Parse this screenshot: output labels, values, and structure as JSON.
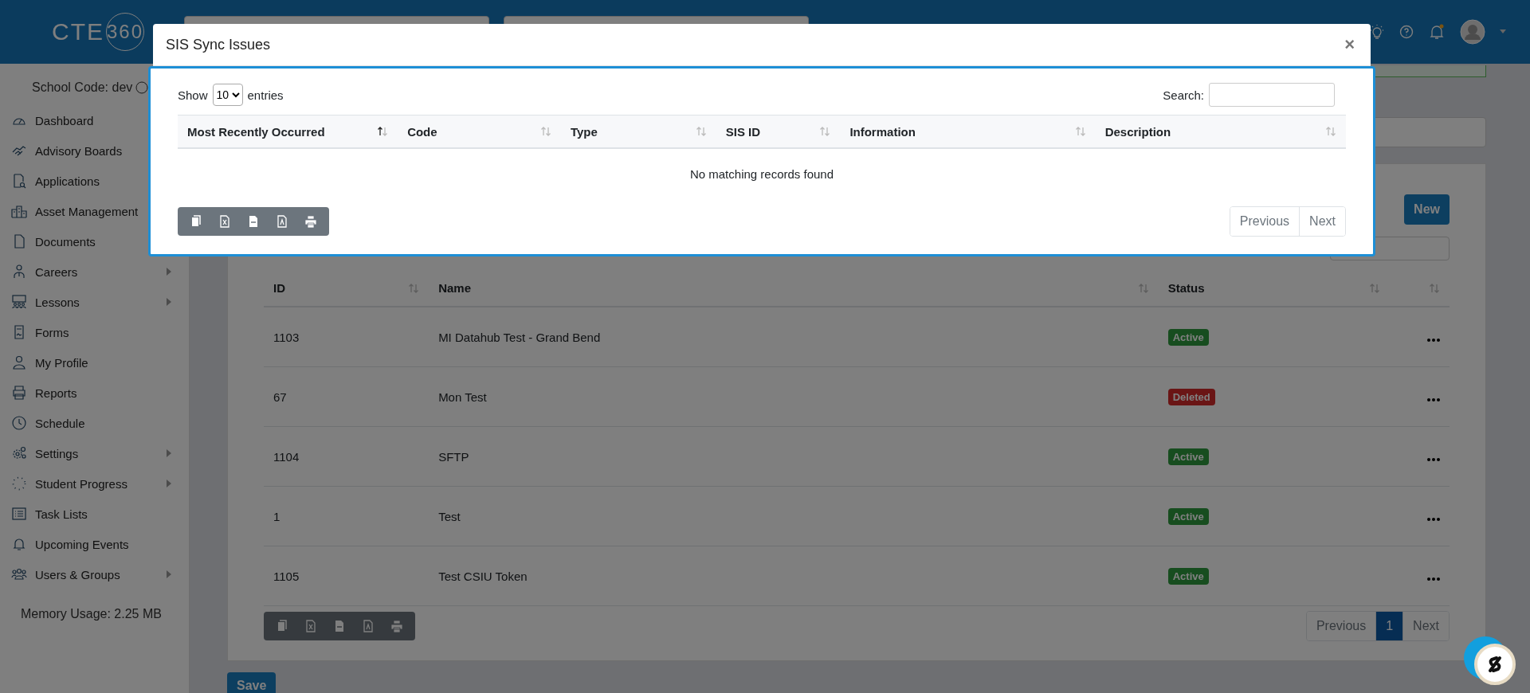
{
  "header": {
    "logo": {
      "text": "CTE",
      "badge": "360"
    }
  },
  "sidebar": {
    "school_code": "School Code: dev",
    "items": [
      {
        "label": "Dashboard"
      },
      {
        "label": "Advisory Boards"
      },
      {
        "label": "Applications"
      },
      {
        "label": "Asset Management"
      },
      {
        "label": "Documents"
      },
      {
        "label": "Careers",
        "has_submenu": true
      },
      {
        "label": "Lessons",
        "has_submenu": true
      },
      {
        "label": "Forms",
        "has_submenu": false
      },
      {
        "label": "My Profile",
        "has_submenu": false
      },
      {
        "label": "Reports",
        "has_submenu": false
      },
      {
        "label": "Schedule",
        "has_submenu": false
      },
      {
        "label": "Settings",
        "has_submenu": true
      },
      {
        "label": "Student Progress",
        "has_submenu": true
      },
      {
        "label": "Task Lists",
        "has_submenu": false
      },
      {
        "label": "Upcoming Events",
        "has_submenu": false
      },
      {
        "label": "Users & Groups",
        "has_submenu": true
      }
    ],
    "memory": "Memory Usage: 2.25 MB"
  },
  "main": {
    "new_button": "New",
    "table": {
      "columns": [
        "ID",
        "Name",
        "Status"
      ],
      "rows": [
        {
          "id": "1103",
          "name": "MI Datahub Test - Grand Bend",
          "status": "Active",
          "kind": "active"
        },
        {
          "id": "67",
          "name": "Mon Test",
          "status": "Deleted",
          "kind": "deleted"
        },
        {
          "id": "1104",
          "name": "SFTP",
          "status": "Active",
          "kind": "active"
        },
        {
          "id": "1",
          "name": "Test",
          "status": "Active",
          "kind": "active"
        },
        {
          "id": "1105",
          "name": "Test CSIU Token",
          "status": "Active",
          "kind": "active"
        }
      ]
    },
    "pagination": {
      "previous": "Previous",
      "pages": [
        {
          "label": "1",
          "selected": true
        }
      ],
      "next": "Next"
    },
    "save_button": "Save"
  },
  "modal": {
    "title": "SIS Sync Issues",
    "close": "×",
    "length": {
      "before": "Show",
      "value": "10",
      "after": "entries"
    },
    "search_label": "Search:",
    "columns": [
      {
        "label": "Most Recently Occurred",
        "sorted": true
      },
      {
        "label": "Code",
        "sorted": false
      },
      {
        "label": "Type",
        "sorted": false
      },
      {
        "label": "SIS ID",
        "sorted": false
      },
      {
        "label": "Information",
        "sorted": false
      },
      {
        "label": "Description",
        "sorted": false
      }
    ],
    "empty_message": "No matching records found",
    "pagination": {
      "previous": "Previous",
      "next": "Next"
    }
  }
}
